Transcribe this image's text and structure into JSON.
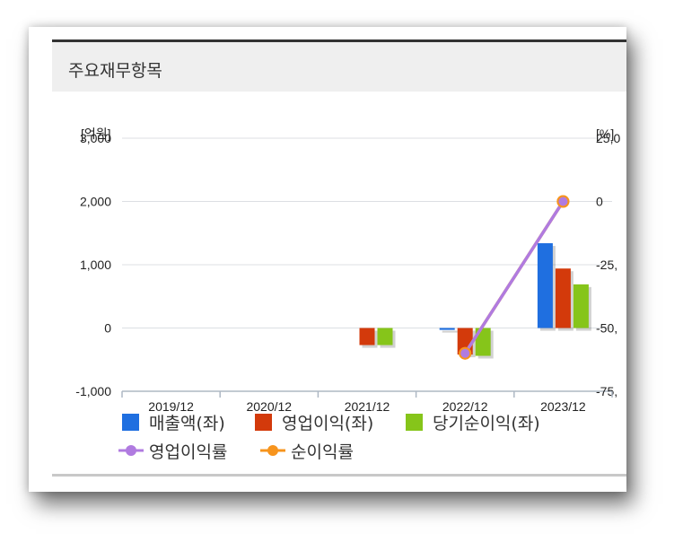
{
  "panel": {
    "title": "주요재무항목"
  },
  "chart_data": {
    "type": "bar",
    "categories": [
      "2019/12",
      "2020/12",
      "2021/12",
      "2022/12",
      "2023/12"
    ],
    "left_axis": {
      "unit_label": "[억원]",
      "ticks": [
        "3,000",
        "2,000",
        "1,000",
        "0",
        "-1,000"
      ],
      "ylim": [
        -1000,
        3000
      ]
    },
    "right_axis": {
      "unit_label": "[%]",
      "ticks": [
        "25,0",
        "0",
        "-25,",
        "-50,",
        "-75,"
      ],
      "ylim": [
        -75,
        25
      ]
    },
    "series": [
      {
        "name": "매출액(좌)",
        "kind": "bar",
        "color": "#1f6fe0",
        "values": [
          0,
          0,
          0,
          -30,
          1340
        ]
      },
      {
        "name": "영업이익(좌)",
        "kind": "bar",
        "color": "#d33a0b",
        "values": [
          0,
          0,
          -270,
          -420,
          940
        ]
      },
      {
        "name": "당기순이익(좌)",
        "kind": "bar",
        "color": "#86c51a",
        "values": [
          0,
          0,
          -270,
          -440,
          690
        ]
      },
      {
        "name": "영업이익률",
        "kind": "line",
        "color": "#b07be0",
        "values": [
          null,
          null,
          null,
          -60,
          0
        ]
      },
      {
        "name": "순이익률",
        "kind": "line",
        "color": "#f7941d",
        "values": [
          null,
          null,
          null,
          -60,
          0
        ]
      }
    ],
    "grid": true,
    "legend": "bottom"
  }
}
